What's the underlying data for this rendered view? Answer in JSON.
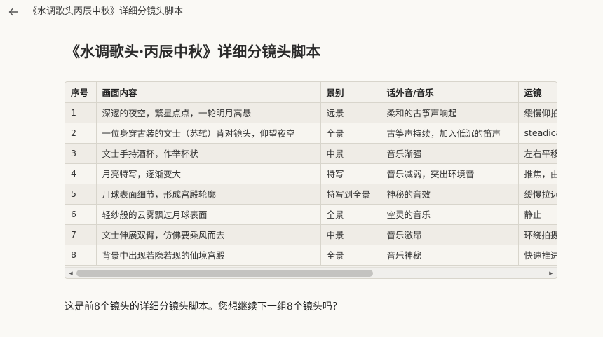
{
  "topbar": {
    "title": "《水调歌头丙辰中秋》详细分镜头脚本"
  },
  "document": {
    "title": "《水调歌头·丙辰中秋》详细分镜头脚本",
    "footer": "这是前8个镜头的详细分镜头脚本。您想继续下一组8个镜头吗？"
  },
  "table": {
    "headers": [
      "序号",
      "画面内容",
      "景别",
      "话外音/音乐",
      "运镜"
    ],
    "rows": [
      [
        "1",
        "深邃的夜空，繁星点点，一轮明月高悬",
        "远景",
        "柔和的古筝声响起",
        "缓慢仰拍"
      ],
      [
        "2",
        "一位身穿古装的文士（苏轼）背对镜头，仰望夜空",
        "全景",
        "古筝声持续，加入低沉的笛声",
        "steadicam"
      ],
      [
        "3",
        "文士手持酒杯，作举杯状",
        "中景",
        "音乐渐强",
        "左右平移"
      ],
      [
        "4",
        "月亮特写，逐渐变大",
        "特写",
        "音乐减弱，突出环境音",
        "推焦，由远及近"
      ],
      [
        "5",
        "月球表面细节，形成宫殿轮廓",
        "特写到全景",
        "神秘的音效",
        "缓慢拉远"
      ],
      [
        "6",
        "轻纱般的云雾飘过月球表面",
        "全景",
        "空灵的音乐",
        "静止"
      ],
      [
        "7",
        "文士伸展双臂，仿佛要乘风而去",
        "中景",
        "音乐激昂",
        "环绕拍摄"
      ],
      [
        "8",
        "背景中出现若隐若现的仙境宫殿",
        "全景",
        "音乐神秘",
        "快速推进"
      ]
    ]
  },
  "icons": {
    "back": "arrow-left-icon",
    "scroll_left": "caret-left-icon",
    "scroll_right": "caret-right-icon"
  }
}
